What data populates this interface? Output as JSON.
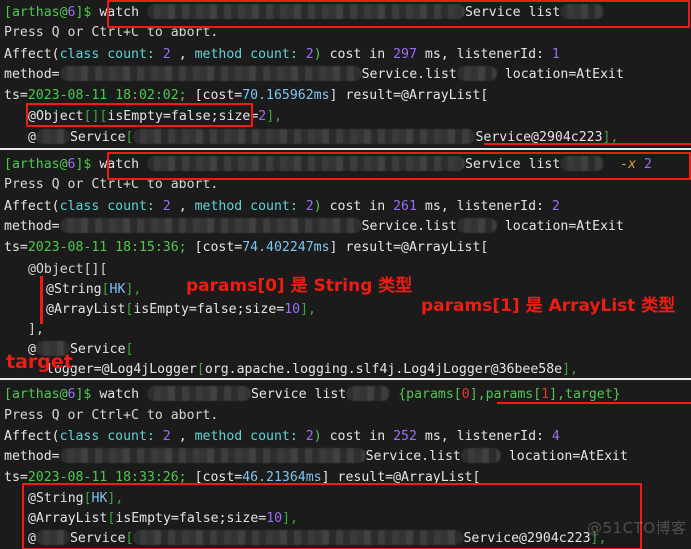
{
  "terminal": {
    "prompt_user": "[arthas@",
    "prompt_id": "6",
    "prompt_tail": "]$",
    "abort_hint": "Press Q or Ctrl+C to abort."
  },
  "block1": {
    "command": "watch",
    "command_tail_service": "Service list",
    "affect_prefix": "Affect(",
    "affect_class_label": "class count: ",
    "affect_class_count": "2",
    "affect_sep": " , ",
    "affect_method_label": "method count: ",
    "affect_method_count": "2",
    "affect_close": ")",
    "cost_label": " cost in ",
    "cost_value": "297",
    "cost_unit": " ms, ",
    "listener_label": "listenerId: ",
    "listener_id": "1",
    "method_label": "method=",
    "method_name": "Service.list",
    "location": "location=AtExit",
    "ts_label": "ts=",
    "ts_value": "2023-08-11 18:02:02;",
    "cost_open": " [cost=",
    "cost_ms": "70.165962ms",
    "cost_close": "]",
    "result_label": " result=@ArrayList[",
    "result_line1_name": "@Object",
    "result_line1_brackets": "[][",
    "result_line1_props": "isEmpty=false;size=",
    "result_line1_size": "2",
    "result_line1_close": "],",
    "result_line2_prefix": "@",
    "result_line2_service": "Service",
    "result_line2_open": "[",
    "result_line2_ref": "Service@2904c223",
    "result_line2_close": "],"
  },
  "block2": {
    "command": "watch",
    "command_tail_service": "Service list",
    "option_flag": "-x",
    "option_value": "2",
    "affect_prefix": "Affect(",
    "affect_class_label": "class count: ",
    "affect_class_count": "2",
    "affect_sep": " , ",
    "affect_method_label": "method count: ",
    "affect_method_count": "2",
    "affect_close": ")",
    "cost_label": " cost in ",
    "cost_value": "261",
    "cost_unit": " ms, ",
    "listener_label": "listenerId: ",
    "listener_id": "2",
    "method_label": "method=",
    "method_name": "Service.list",
    "location": "location=AtExit",
    "ts_label": "ts=",
    "ts_value": "2023-08-11 18:15:36;",
    "cost_open": " [cost=",
    "cost_ms": "74.402247ms",
    "cost_close": "]",
    "result_label": " result=@ArrayList[",
    "obj_line": "@Object[][",
    "string_name": "@String",
    "string_open": "[",
    "string_value": "HK",
    "string_close": "],",
    "arraylist_name": "@ArrayList",
    "arraylist_open": "[",
    "arraylist_props": "isEmpty=false;size=",
    "arraylist_size": "10",
    "arraylist_close": "],",
    "close_bracket": "],",
    "service_prefix": "@",
    "service_name": "Service",
    "service_open": "[",
    "logger_label": "logger=",
    "logger_name": "@Log4jLogger",
    "logger_open": "[",
    "logger_value": "org.apache.logging.slf4j.Log4jLogger@36bee58e",
    "logger_close": "],",
    "annot_params0": "params[0] 是 String 类型",
    "annot_params1": "params[1] 是 ArrayList 类型",
    "annot_target": "target"
  },
  "block3": {
    "command": "watch",
    "command_tail_service": "Service list",
    "express": "{params[0],params[1],target}",
    "express_p0": "0",
    "express_p1": "1",
    "affect_prefix": "Affect(",
    "affect_class_label": "class count: ",
    "affect_class_count": "2",
    "affect_sep": " , ",
    "affect_method_label": "method count: ",
    "affect_method_count": "2",
    "affect_close": ")",
    "cost_label": " cost in ",
    "cost_value": "252",
    "cost_unit": " ms, ",
    "listener_label": "listenerId: ",
    "listener_id": "4",
    "method_label": "method=",
    "method_name": "Service.list",
    "location": "location=AtExit",
    "ts_label": "ts=",
    "ts_value": "2023-08-11 18:33:26;",
    "cost_open": " [cost=",
    "cost_ms": "46.21364ms",
    "cost_close": "]",
    "result_label": " result=@ArrayList[",
    "string_name": "@String",
    "string_open": "[",
    "string_value": "HK",
    "string_close": "],",
    "arraylist_name": "@ArrayList",
    "arraylist_open": "[",
    "arraylist_props": "isEmpty=false;size=",
    "arraylist_size": "10",
    "arraylist_close": "],",
    "service_prefix": "@",
    "service_name": "Service",
    "service_open": "[",
    "service_ref": "Service@2904c223",
    "service_close": "],"
  },
  "watermark": "@51CTO博客",
  "colors": {
    "background": "#1b1b1b",
    "green": "#4ec94e",
    "purple": "#9b6ef3",
    "cyan": "#63d2d2",
    "annotation_red": "#ee1c12",
    "white": "#e4e4e4"
  }
}
